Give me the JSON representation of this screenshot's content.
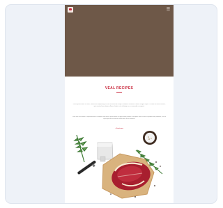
{
  "page": {
    "title": "VEAL RECIPES",
    "paragraph_1": "Lorem ipsum dolor sit amet, consectetur adipiscing elit, sed do eiusmod tempor incididunt ut labore et dolore magna aliqua. Ut enim ad minim veniam, quis nostrud exercitation ullamco laboris nisi ut aliquip ex ea commodo consequat.",
    "paragraph_2": "Duis aute irure dolor in reprehenderit in voluptate velit esse cillum dolore eu fugiat nulla pariatur. Excepteur sint occaecat cupidatat non proident, sunt in culpa qui officia deserunt mollit anim id est laborum.",
    "link": "+ Read more",
    "menu_icon": "menu-icon",
    "logo_icon": "logo-icon"
  },
  "colors": {
    "hero": "#6e5848",
    "accent": "#c8273b",
    "card": "#eef2f8"
  }
}
